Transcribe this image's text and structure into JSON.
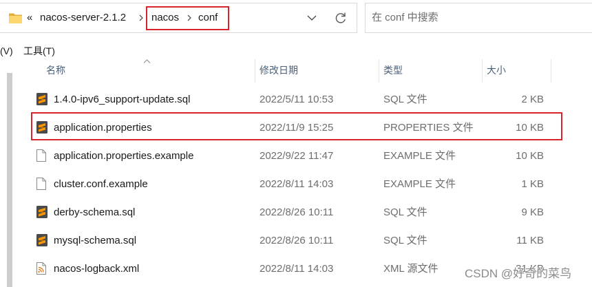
{
  "address_bar": {
    "folder_icon": "folder-icon",
    "overflow": "«",
    "path": [
      "nacos-server-2.1.2",
      "nacos",
      "conf"
    ],
    "separator_icon": "chevron-right-icon",
    "history_icon": "chevron-down-icon",
    "refresh_icon": "refresh-icon"
  },
  "search": {
    "placeholder": "在 conf 中搜索"
  },
  "menu": {
    "view": "(V)",
    "tools": "工具(T)"
  },
  "columns": {
    "name": "名称",
    "modified": "修改日期",
    "type": "类型",
    "size": "大小",
    "sort_icon": "sort-ascending-icon"
  },
  "files": [
    {
      "icon": "sublime-file-icon",
      "name": "1.4.0-ipv6_support-update.sql",
      "modified": "2022/5/11 10:53",
      "type": "SQL 文件",
      "size": "2 KB",
      "highlighted": false
    },
    {
      "icon": "sublime-file-icon",
      "name": "application.properties",
      "modified": "2022/11/9 15:25",
      "type": "PROPERTIES 文件",
      "size": "10 KB",
      "highlighted": true
    },
    {
      "icon": "blank-file-icon",
      "name": "application.properties.example",
      "modified": "2022/9/22 11:47",
      "type": "EXAMPLE 文件",
      "size": "10 KB",
      "highlighted": false
    },
    {
      "icon": "blank-file-icon",
      "name": "cluster.conf.example",
      "modified": "2022/8/11 14:03",
      "type": "EXAMPLE 文件",
      "size": "1 KB",
      "highlighted": false
    },
    {
      "icon": "sublime-file-icon",
      "name": "derby-schema.sql",
      "modified": "2022/8/26 10:11",
      "type": "SQL 文件",
      "size": "9 KB",
      "highlighted": false
    },
    {
      "icon": "sublime-file-icon",
      "name": "mysql-schema.sql",
      "modified": "2022/8/26 10:11",
      "type": "SQL 文件",
      "size": "11 KB",
      "highlighted": false
    },
    {
      "icon": "xml-file-icon",
      "name": "nacos-logback.xml",
      "modified": "2022/8/11 14:03",
      "type": "XML 源文件",
      "size": "31 KB",
      "highlighted": false
    }
  ],
  "colors": {
    "annotation": "#d9232b",
    "header_text": "#4c607a",
    "secondary_text": "#6d6d6d"
  },
  "watermark": "CSDN @好奇的菜鸟"
}
